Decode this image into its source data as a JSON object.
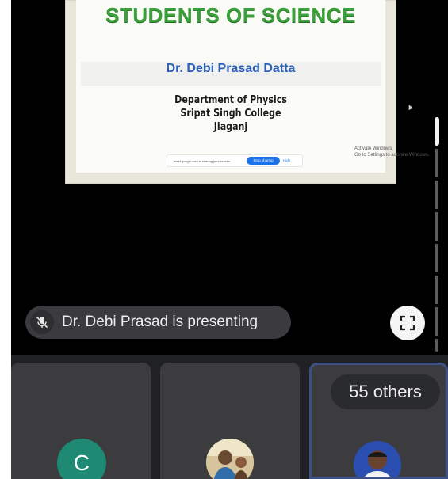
{
  "slide": {
    "title": "STUDENTS OF SCIENCE",
    "author": "Dr. Debi Prasad Datta",
    "department": "Department of Physics",
    "college": "Sripat Singh College",
    "city": "Jiaganj",
    "share_notice": "meet.google.com is sharing your screen.",
    "stop_sharing_label": "Stop sharing",
    "hide_label": "Hide"
  },
  "watermark": {
    "line1": "Activate Windows",
    "line2": "Go to Settings to activate Windows."
  },
  "presenter": {
    "text": "Dr. Debi Prasad is presenting",
    "mic_icon": "mic-off-icon"
  },
  "fullscreen": {
    "icon": "fullscreen-icon"
  },
  "participants": {
    "tile1_initial": "C",
    "others_label": "55 others"
  },
  "colors": {
    "slide_title": "#3aa13a",
    "slide_author": "#2b62b8",
    "avatar_c": "#1e8a74",
    "tile_bg": "#3c3c3f",
    "pill_bg": "#3b3b3f"
  }
}
